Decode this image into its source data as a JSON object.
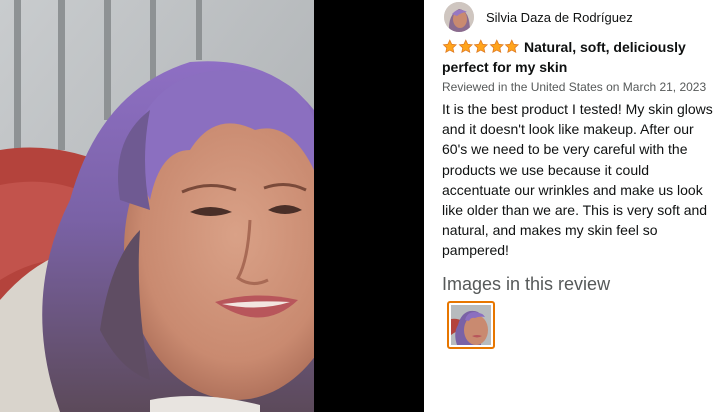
{
  "reviewer": {
    "name": "Silvia Daza de Rodríguez"
  },
  "review": {
    "rating": 5,
    "rating_max": 5,
    "title": "Natural, soft, deliciously perfect for my skin",
    "date": "Reviewed in the United States on March 21, 2023",
    "body": "It is the best product I tested! My skin glows and it doesn't look like makeup. After our 60's we need to be very careful with the products we use because it could accentuate our wrinkles and make us look like older than we are. This is very soft and natural, and makes my skin feel so pampered!"
  },
  "images_section": {
    "heading": "Images in this review",
    "thumbnail_count": 1
  },
  "colors": {
    "star": "#ffa41c",
    "thumbnail_border": "#e77600",
    "secondary_text": "#565959",
    "viewer_background": "#000000"
  },
  "icons": {
    "star": "star-icon"
  }
}
